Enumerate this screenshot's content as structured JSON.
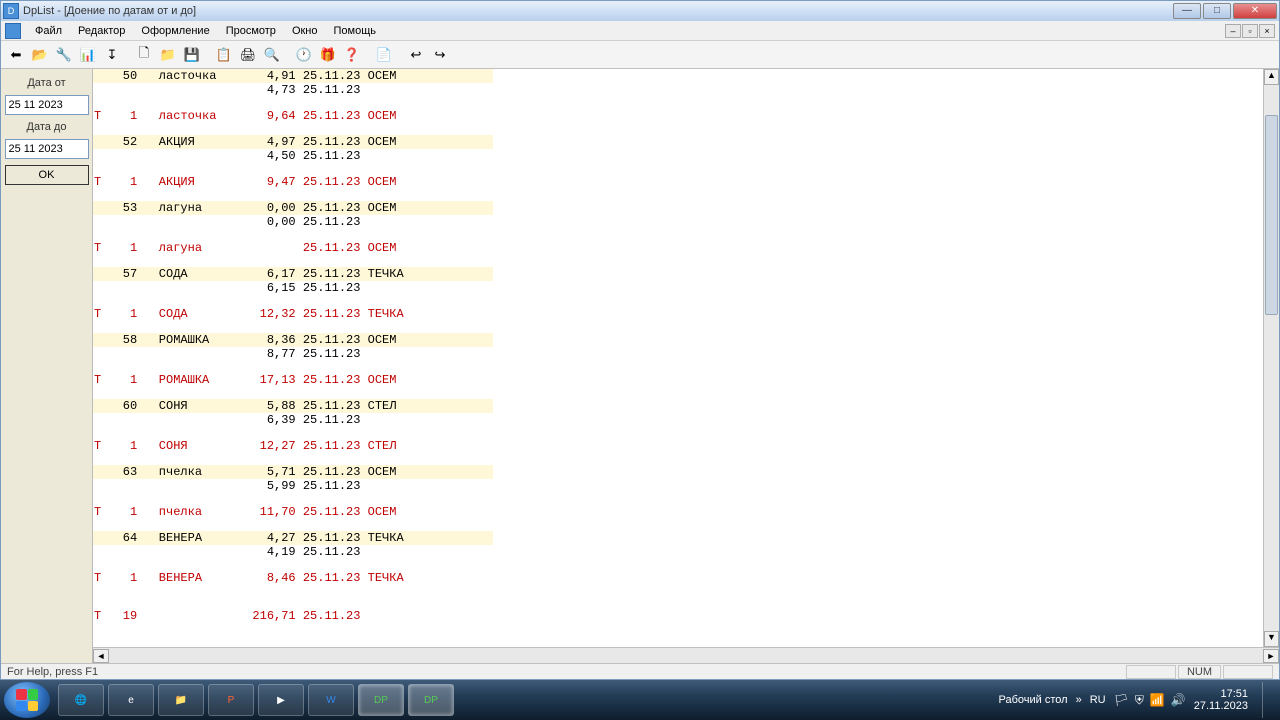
{
  "window": {
    "title": "DpList - [Доение по датам от и до]",
    "app_icon_text": "D"
  },
  "menu": {
    "items": [
      "Файл",
      "Редактор",
      "Оформление",
      "Просмотр",
      "Окно",
      "Помощь"
    ]
  },
  "toolbar": {
    "buttons": [
      "⬅",
      "📂",
      "🔧",
      "📊",
      "↧",
      "",
      "🗋",
      "📁",
      "💾",
      "",
      "📋",
      "🖨",
      "🔍",
      "",
      "🕐",
      "🎁",
      "❓",
      "",
      "📄",
      "",
      "↩",
      "↪"
    ]
  },
  "sidebar": {
    "date_from_label": "Дата от",
    "date_from_value": "25 11 2023",
    "date_to_label": "Дата до",
    "date_to_value": "25 11 2023",
    "ok_label": "OK"
  },
  "report": {
    "rows": [
      {
        "t": "",
        "n": "50",
        "name": "ласточка",
        "v": "4,91",
        "d": "25.11.23",
        "s": "ОСЕМ",
        "cls": "blk hl"
      },
      {
        "t": "",
        "n": "",
        "name": "",
        "v": "4,73",
        "d": "25.11.23",
        "s": "",
        "cls": "blk"
      },
      {
        "spacer": true
      },
      {
        "t": "Т",
        "n": "1",
        "name": "ласточка",
        "v": "9,64",
        "d": "25.11.23",
        "s": "ОСЕМ",
        "cls": "red"
      },
      {
        "spacer": true
      },
      {
        "t": "",
        "n": "52",
        "name": "АКЦИЯ",
        "v": "4,97",
        "d": "25.11.23",
        "s": "ОСЕМ",
        "cls": "blk hl"
      },
      {
        "t": "",
        "n": "",
        "name": "",
        "v": "4,50",
        "d": "25.11.23",
        "s": "",
        "cls": "blk"
      },
      {
        "spacer": true
      },
      {
        "t": "Т",
        "n": "1",
        "name": "АКЦИЯ",
        "v": "9,47",
        "d": "25.11.23",
        "s": "ОСЕМ",
        "cls": "red"
      },
      {
        "spacer": true
      },
      {
        "t": "",
        "n": "53",
        "name": "лагуна",
        "v": "0,00",
        "d": "25.11.23",
        "s": "ОСЕМ",
        "cls": "blk hl"
      },
      {
        "t": "",
        "n": "",
        "name": "",
        "v": "0,00",
        "d": "25.11.23",
        "s": "",
        "cls": "blk"
      },
      {
        "spacer": true
      },
      {
        "t": "Т",
        "n": "1",
        "name": "лагуна",
        "v": "",
        "d": "25.11.23",
        "s": "ОСЕМ",
        "cls": "red"
      },
      {
        "spacer": true
      },
      {
        "t": "",
        "n": "57",
        "name": "СОДА",
        "v": "6,17",
        "d": "25.11.23",
        "s": "ТЕЧКА",
        "cls": "blk hl"
      },
      {
        "t": "",
        "n": "",
        "name": "",
        "v": "6,15",
        "d": "25.11.23",
        "s": "",
        "cls": "blk"
      },
      {
        "spacer": true
      },
      {
        "t": "Т",
        "n": "1",
        "name": "СОДА",
        "v": "12,32",
        "d": "25.11.23",
        "s": "ТЕЧКА",
        "cls": "red"
      },
      {
        "spacer": true
      },
      {
        "t": "",
        "n": "58",
        "name": "РОМАШКА",
        "v": "8,36",
        "d": "25.11.23",
        "s": "ОСЕМ",
        "cls": "blk hl"
      },
      {
        "t": "",
        "n": "",
        "name": "",
        "v": "8,77",
        "d": "25.11.23",
        "s": "",
        "cls": "blk"
      },
      {
        "spacer": true
      },
      {
        "t": "Т",
        "n": "1",
        "name": "РОМАШКА",
        "v": "17,13",
        "d": "25.11.23",
        "s": "ОСЕМ",
        "cls": "red"
      },
      {
        "spacer": true
      },
      {
        "t": "",
        "n": "60",
        "name": "СОНЯ",
        "v": "5,88",
        "d": "25.11.23",
        "s": "СТЕЛ",
        "cls": "blk hl"
      },
      {
        "t": "",
        "n": "",
        "name": "",
        "v": "6,39",
        "d": "25.11.23",
        "s": "",
        "cls": "blk"
      },
      {
        "spacer": true
      },
      {
        "t": "Т",
        "n": "1",
        "name": "СОНЯ",
        "v": "12,27",
        "d": "25.11.23",
        "s": "СТЕЛ",
        "cls": "red"
      },
      {
        "spacer": true
      },
      {
        "t": "",
        "n": "63",
        "name": "пчелка",
        "v": "5,71",
        "d": "25.11.23",
        "s": "ОСЕМ",
        "cls": "blk hl"
      },
      {
        "t": "",
        "n": "",
        "name": "",
        "v": "5,99",
        "d": "25.11.23",
        "s": "",
        "cls": "blk"
      },
      {
        "spacer": true
      },
      {
        "t": "Т",
        "n": "1",
        "name": "пчелка",
        "v": "11,70",
        "d": "25.11.23",
        "s": "ОСЕМ",
        "cls": "red"
      },
      {
        "spacer": true
      },
      {
        "t": "",
        "n": "64",
        "name": "ВЕНЕРА",
        "v": "4,27",
        "d": "25.11.23",
        "s": "ТЕЧКА",
        "cls": "blk hl"
      },
      {
        "t": "",
        "n": "",
        "name": "",
        "v": "4,19",
        "d": "25.11.23",
        "s": "",
        "cls": "blk"
      },
      {
        "spacer": true
      },
      {
        "t": "Т",
        "n": "1",
        "name": "ВЕНЕРА",
        "v": "8,46",
        "d": "25.11.23",
        "s": "ТЕЧКА",
        "cls": "red"
      },
      {
        "spacer": true
      },
      {
        "spacer": true
      },
      {
        "t": "Т",
        "n": "19",
        "name": "",
        "v": "216,71",
        "d": "25.11.23",
        "s": "",
        "cls": "red"
      }
    ]
  },
  "statusbar": {
    "help": "For Help, press F1",
    "num": "NUM"
  },
  "taskbar": {
    "desktop_label": "Рабочий стол",
    "lang": "RU",
    "time": "17:51",
    "date": "27.11.2023"
  }
}
